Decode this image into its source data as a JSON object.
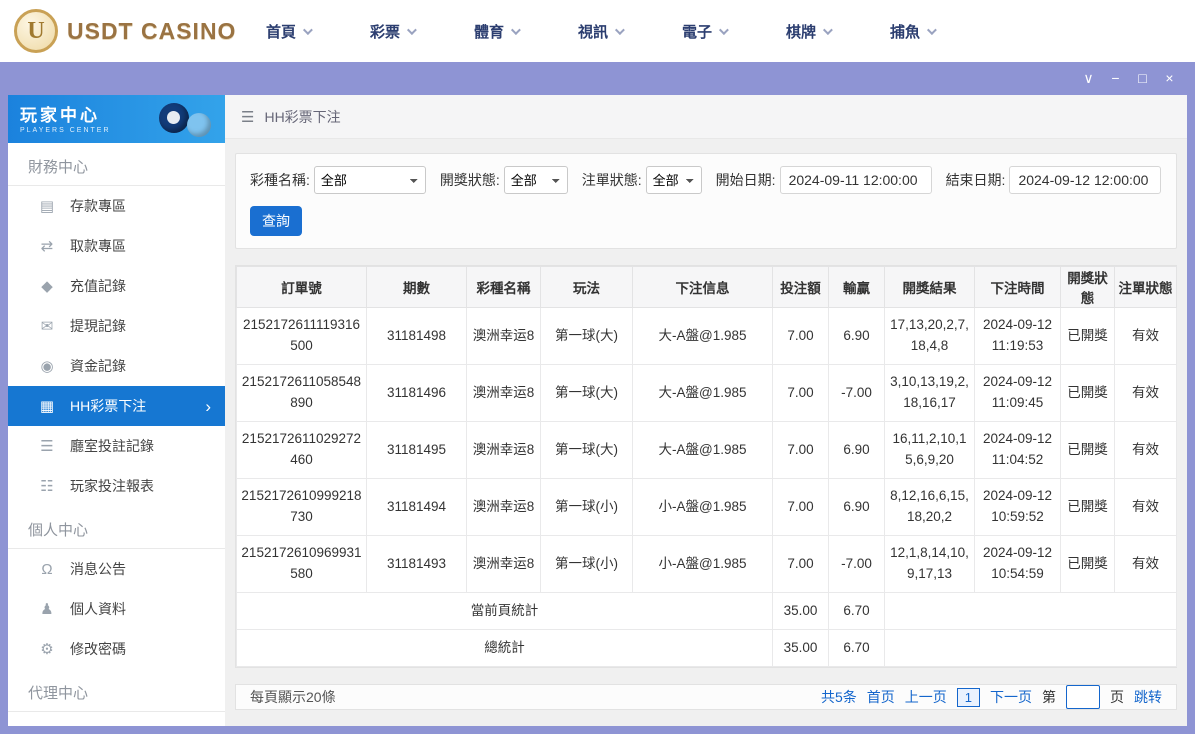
{
  "colors": {
    "accent_blue": "#1677d2",
    "titlebar_lavender": "#8e94d4",
    "link_blue": "#1466cc",
    "logo_gold": "#9a7342"
  },
  "icons": {
    "menu": "☰",
    "chevron_right": "›"
  },
  "topnav": {
    "logo_text": "USDT CASINO",
    "logo_monogram": "U",
    "items": [
      "首頁",
      "彩票",
      "體育",
      "視訊",
      "電子",
      "棋牌",
      "捕魚"
    ]
  },
  "titlebar": {
    "collapse_icon": "∨",
    "minimize_icon": "−",
    "maximize_icon": "□",
    "close_icon": "×"
  },
  "sidebar": {
    "title": "玩家中心",
    "subtitle": "PLAYERS CENTER",
    "sections": [
      {
        "label": "財務中心",
        "items": [
          {
            "label": "存款專區",
            "icon": "deposit-icon",
            "glyph": "▤"
          },
          {
            "label": "取款專區",
            "icon": "withdraw-icon",
            "glyph": "⇄"
          },
          {
            "label": "充值記錄",
            "icon": "recharge-record-icon",
            "glyph": "◆"
          },
          {
            "label": "提現記錄",
            "icon": "cashout-record-icon",
            "glyph": "✉"
          },
          {
            "label": "資金記錄",
            "icon": "funds-record-icon",
            "glyph": "◉"
          },
          {
            "label": "HH彩票下注",
            "icon": "lottery-bet-icon",
            "glyph": "▦"
          },
          {
            "label": "廳室投註記錄",
            "icon": "hall-bet-records-icon",
            "glyph": "☰"
          },
          {
            "label": "玩家投注報表",
            "icon": "bet-report-icon",
            "glyph": "☷"
          }
        ]
      },
      {
        "label": "個人中心",
        "items": [
          {
            "label": "消息公告",
            "icon": "announcement-icon",
            "glyph": "Ω"
          },
          {
            "label": "個人資料",
            "icon": "profile-icon",
            "glyph": "♟"
          },
          {
            "label": "修改密碼",
            "icon": "password-icon",
            "glyph": "⚙"
          }
        ]
      },
      {
        "label": "代理中心",
        "items": []
      }
    ]
  },
  "main": {
    "breadcrumb": "HH彩票下注",
    "filters": {
      "lottery_label": "彩種名稱:",
      "lottery_value": "全部",
      "draw_status_label": "開獎狀態:",
      "draw_status_value": "全部",
      "order_status_label": "注單狀態:",
      "order_status_value": "全部",
      "start_date_label": "開始日期:",
      "start_date_value": "2024-09-11 12:00:00",
      "end_date_label": "結束日期:",
      "end_date_value": "2024-09-12 12:00:00",
      "search_label": "查詢"
    },
    "table": {
      "headers": [
        "訂單號",
        "期數",
        "彩種名稱",
        "玩法",
        "下注信息",
        "投注額",
        "輸贏",
        "開獎結果",
        "下注時間",
        "開獎狀態",
        "注單狀態"
      ],
      "rows": [
        {
          "order_no": "2152172611119316500",
          "period": "31181498",
          "lottery": "澳洲幸运8",
          "play": "第一球(大)",
          "bet_info": "大-A盤@1.985",
          "amount": "7.00",
          "win_loss": "6.90",
          "result": "17,13,20,2,7,18,4,8",
          "time": "2024-09-12 11:19:53",
          "draw_status": "已開獎",
          "order_status": "有效"
        },
        {
          "order_no": "2152172611058548890",
          "period": "31181496",
          "lottery": "澳洲幸运8",
          "play": "第一球(大)",
          "bet_info": "大-A盤@1.985",
          "amount": "7.00",
          "win_loss": "-7.00",
          "result": "3,10,13,19,2,18,16,17",
          "time": "2024-09-12 11:09:45",
          "draw_status": "已開獎",
          "order_status": "有效"
        },
        {
          "order_no": "2152172611029272460",
          "period": "31181495",
          "lottery": "澳洲幸运8",
          "play": "第一球(大)",
          "bet_info": "大-A盤@1.985",
          "amount": "7.00",
          "win_loss": "6.90",
          "result": "16,11,2,10,15,6,9,20",
          "time": "2024-09-12 11:04:52",
          "draw_status": "已開獎",
          "order_status": "有效"
        },
        {
          "order_no": "2152172610999218730",
          "period": "31181494",
          "lottery": "澳洲幸运8",
          "play": "第一球(小)",
          "bet_info": "小-A盤@1.985",
          "amount": "7.00",
          "win_loss": "6.90",
          "result": "8,12,16,6,15,18,20,2",
          "time": "2024-09-12 10:59:52",
          "draw_status": "已開獎",
          "order_status": "有效"
        },
        {
          "order_no": "2152172610969931580",
          "period": "31181493",
          "lottery": "澳洲幸运8",
          "play": "第一球(小)",
          "bet_info": "小-A盤@1.985",
          "amount": "7.00",
          "win_loss": "-7.00",
          "result": "12,1,8,14,10,9,17,13",
          "time": "2024-09-12 10:54:59",
          "draw_status": "已開獎",
          "order_status": "有效"
        }
      ],
      "page_summary": {
        "label": "當前頁統計",
        "bet_total": "35.00",
        "win_loss_total": "6.70"
      },
      "grand_summary": {
        "label": "總統計",
        "bet_total": "35.00",
        "win_loss_total": "6.70"
      }
    },
    "pagination": {
      "page_size_text": "每頁顯示20條",
      "total_text": "共5条",
      "first_label": "首页",
      "prev_label": "上一页",
      "current_page": "1",
      "next_label": "下一页",
      "jump_prefix": "第",
      "jump_suffix": "页",
      "jump_label": "跳转",
      "jump_value": ""
    }
  }
}
